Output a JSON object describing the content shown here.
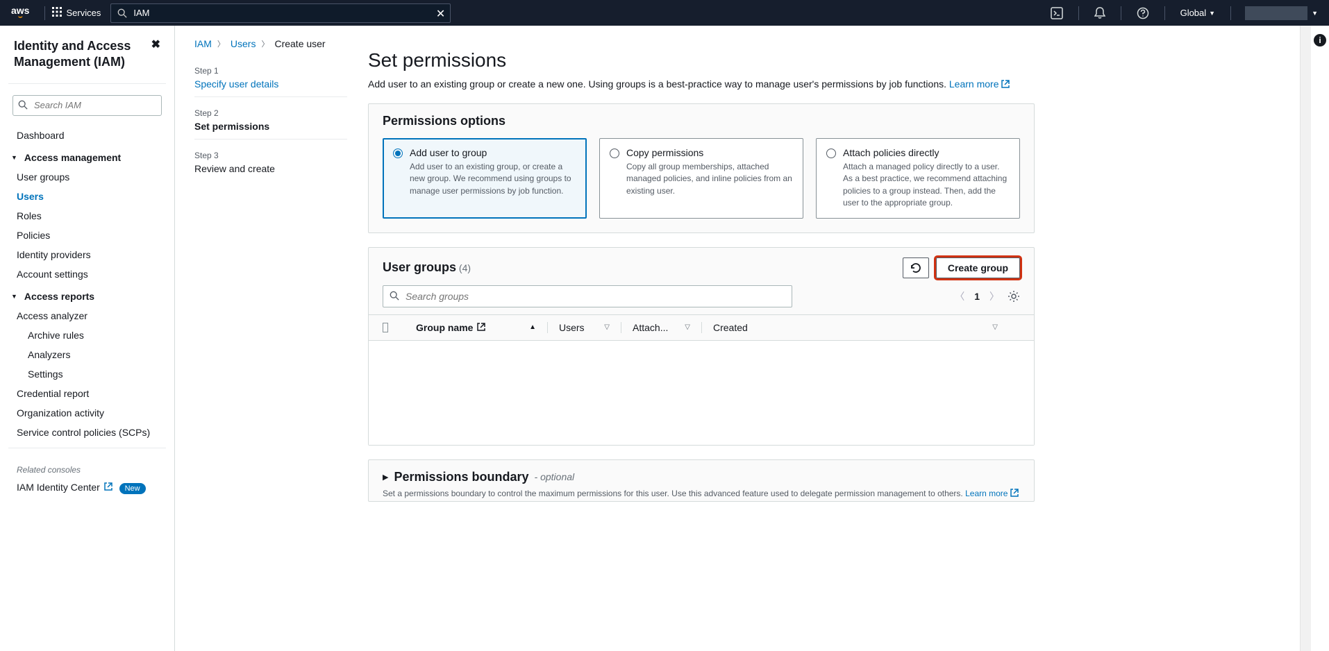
{
  "topnav": {
    "logo": "aws",
    "services": "Services",
    "search_value": "IAM",
    "region": "Global"
  },
  "sidebar": {
    "title": "Identity and Access Management (IAM)",
    "search_placeholder": "Search IAM",
    "dashboard": "Dashboard",
    "sections": {
      "access_mgmt": "Access management",
      "access_reports": "Access reports"
    },
    "items": {
      "user_groups": "User groups",
      "users": "Users",
      "roles": "Roles",
      "policies": "Policies",
      "identity_providers": "Identity providers",
      "account_settings": "Account settings",
      "access_analyzer": "Access analyzer",
      "archive_rules": "Archive rules",
      "analyzers": "Analyzers",
      "settings": "Settings",
      "credential_report": "Credential report",
      "org_activity": "Organization activity",
      "scps": "Service control policies (SCPs)"
    },
    "related": "Related consoles",
    "identity_center": "IAM Identity Center",
    "new_badge": "New"
  },
  "breadcrumb": {
    "iam": "IAM",
    "users": "Users",
    "create_user": "Create user"
  },
  "steps": {
    "s1_num": "Step 1",
    "s1_name": "Specify user details",
    "s2_num": "Step 2",
    "s2_name": "Set permissions",
    "s3_num": "Step 3",
    "s3_name": "Review and create"
  },
  "page": {
    "title": "Set permissions",
    "desc_pre": "Add user to an existing group or create a new one. Using groups is a best-practice way to manage user's permissions by job functions. ",
    "learn_more": "Learn more"
  },
  "perm_options": {
    "title": "Permissions options",
    "add_group": {
      "title": "Add user to group",
      "desc": "Add user to an existing group, or create a new group. We recommend using groups to manage user permissions by job function."
    },
    "copy": {
      "title": "Copy permissions",
      "desc": "Copy all group memberships, attached managed policies, and inline policies from an existing user."
    },
    "attach": {
      "title": "Attach policies directly",
      "desc": "Attach a managed policy directly to a user. As a best practice, we recommend attaching policies to a group instead. Then, add the user to the appropriate group."
    }
  },
  "groups": {
    "title": "User groups",
    "count": "(4)",
    "refresh": "Refresh",
    "create": "Create group",
    "search_placeholder": "Search groups",
    "page": "1",
    "cols": {
      "name": "Group name",
      "users": "Users",
      "attached": "Attach...",
      "created": "Created"
    }
  },
  "boundary": {
    "title": "Permissions boundary",
    "optional": "- optional",
    "desc_pre": "Set a permissions boundary to control the maximum permissions for this user. Use this advanced feature used to delegate permission management to others. ",
    "learn_more": "Learn more"
  }
}
